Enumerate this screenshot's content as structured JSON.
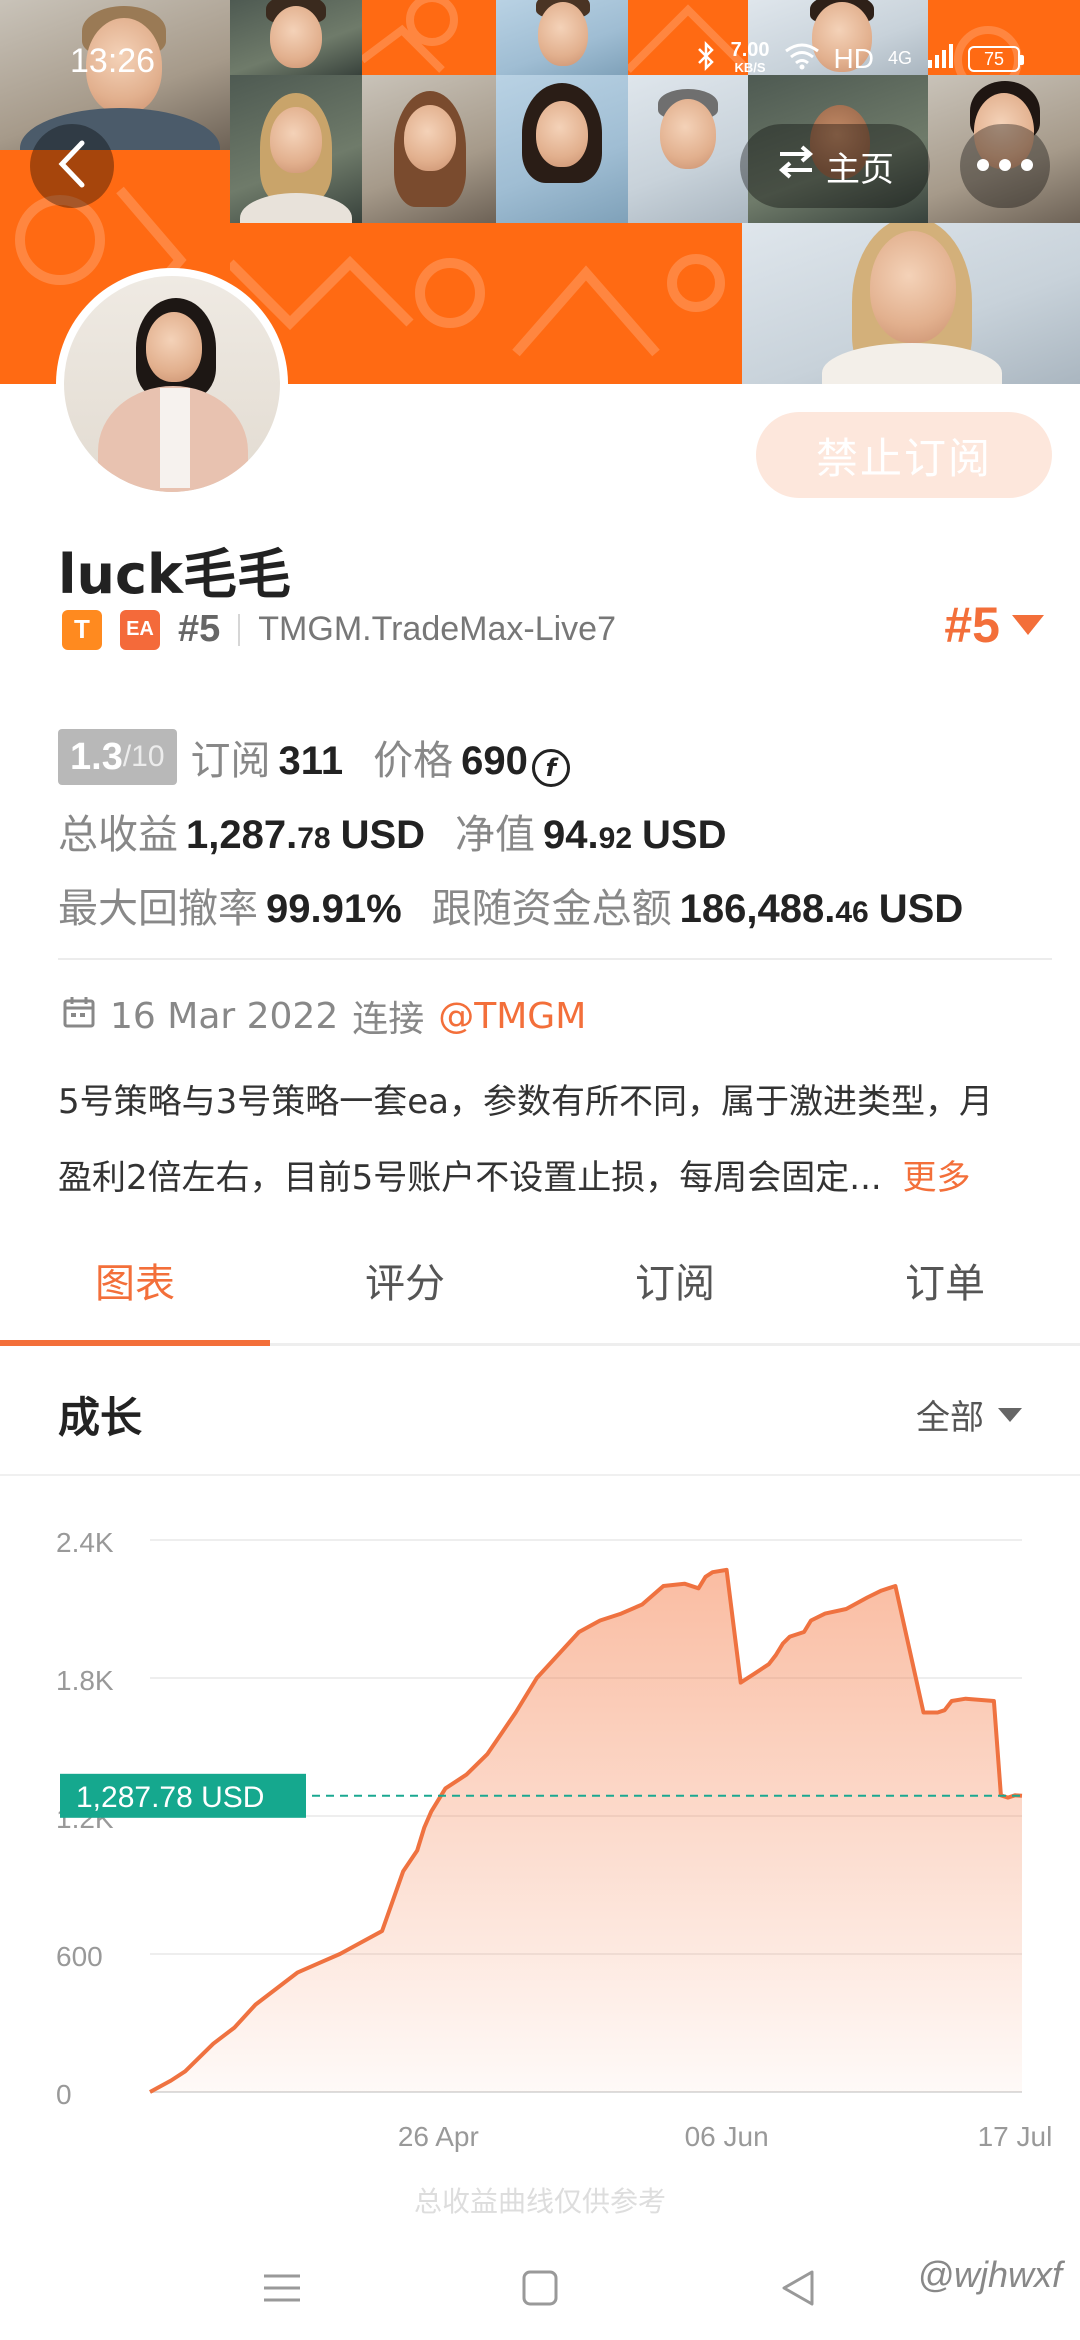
{
  "status_bar": {
    "time": "13:26",
    "net_speed_value": "7.00",
    "net_speed_unit": "KB/S",
    "hd": "HD",
    "network": "4G",
    "battery": "75"
  },
  "header": {
    "home_label": "主页",
    "subscribe_button": "禁止订阅"
  },
  "profile": {
    "username": "luck毛毛",
    "tag_t": "T",
    "tag_ea": "EA",
    "rank_small": "#5",
    "server": "TMGM.TradeMax-Live7",
    "rank_big": "#5"
  },
  "stats": {
    "score_value": "1.3",
    "score_max": "/10",
    "subscribe_label": "订阅",
    "subscribe_count": "311",
    "price_label": "价格",
    "price_value": "690",
    "total_profit_label": "总收益",
    "total_profit_main": "1,287.",
    "total_profit_dec": "78",
    "total_profit_unit": "USD",
    "net_value_label": "净值",
    "net_value_main": "94.",
    "net_value_dec": "92",
    "net_value_unit": "USD",
    "max_drawdown_label": "最大回撤率",
    "max_drawdown_value": "99.91%",
    "follow_funds_label": "跟随资金总额",
    "follow_funds_main": "186,488.",
    "follow_funds_dec": "46",
    "follow_funds_unit": "USD"
  },
  "info": {
    "date": "16 Mar 2022",
    "connect_label": "连接",
    "broker": "@TMGM",
    "description_line1": "5号策略与3号策略一套ea，参数有所不同，属于激进类型，月",
    "description_line2": "盈利2倍左右，目前5号账户不设置止损，每周会固定...",
    "more": "更多"
  },
  "tabs": [
    {
      "label": "图表"
    },
    {
      "label": "评分"
    },
    {
      "label": "订阅"
    },
    {
      "label": "订单"
    }
  ],
  "section": {
    "title": "成长",
    "range": "全部"
  },
  "chart_data": {
    "type": "area",
    "title": "成长",
    "y_ticks": [
      "0",
      "600",
      "1.2K",
      "1.8K",
      "2.4K"
    ],
    "ylim": [
      0,
      2400
    ],
    "x_ticks": [
      "26 Apr",
      "06 Jun",
      "17 Jul"
    ],
    "x_tick_days": [
      41,
      82,
      123
    ],
    "current_value_label": "1,287.78 USD",
    "current_value": 1287.78,
    "series": [
      {
        "x_days": [
          0,
          3,
          5,
          9,
          12,
          15,
          18,
          21,
          24,
          27,
          30,
          33,
          36,
          38,
          39,
          40,
          42,
          45,
          48,
          50,
          52,
          55,
          58,
          61,
          64,
          67,
          70,
          73,
          76,
          78,
          79,
          80,
          82,
          84,
          86,
          88,
          89,
          90,
          91,
          93,
          94,
          96,
          99,
          102,
          104,
          106,
          110,
          112,
          113,
          114,
          116,
          120,
          121,
          122,
          123,
          124
        ],
        "values": [
          0,
          50,
          90,
          210,
          280,
          380,
          450,
          520,
          560,
          600,
          650,
          700,
          960,
          1050,
          1150,
          1220,
          1320,
          1380,
          1470,
          1560,
          1650,
          1800,
          1900,
          2000,
          2050,
          2080,
          2120,
          2200,
          2210,
          2190,
          2240,
          2260,
          2270,
          1780,
          1820,
          1860,
          1900,
          1950,
          1980,
          2000,
          2050,
          2080,
          2100,
          2150,
          2180,
          2200,
          1650,
          1650,
          1660,
          1700,
          1710,
          1700,
          1290,
          1280,
          1290,
          1287.78
        ]
      }
    ]
  },
  "footer": {
    "faded_text": "总收益曲线仅供参考",
    "watermark": "@wjhwxf"
  }
}
